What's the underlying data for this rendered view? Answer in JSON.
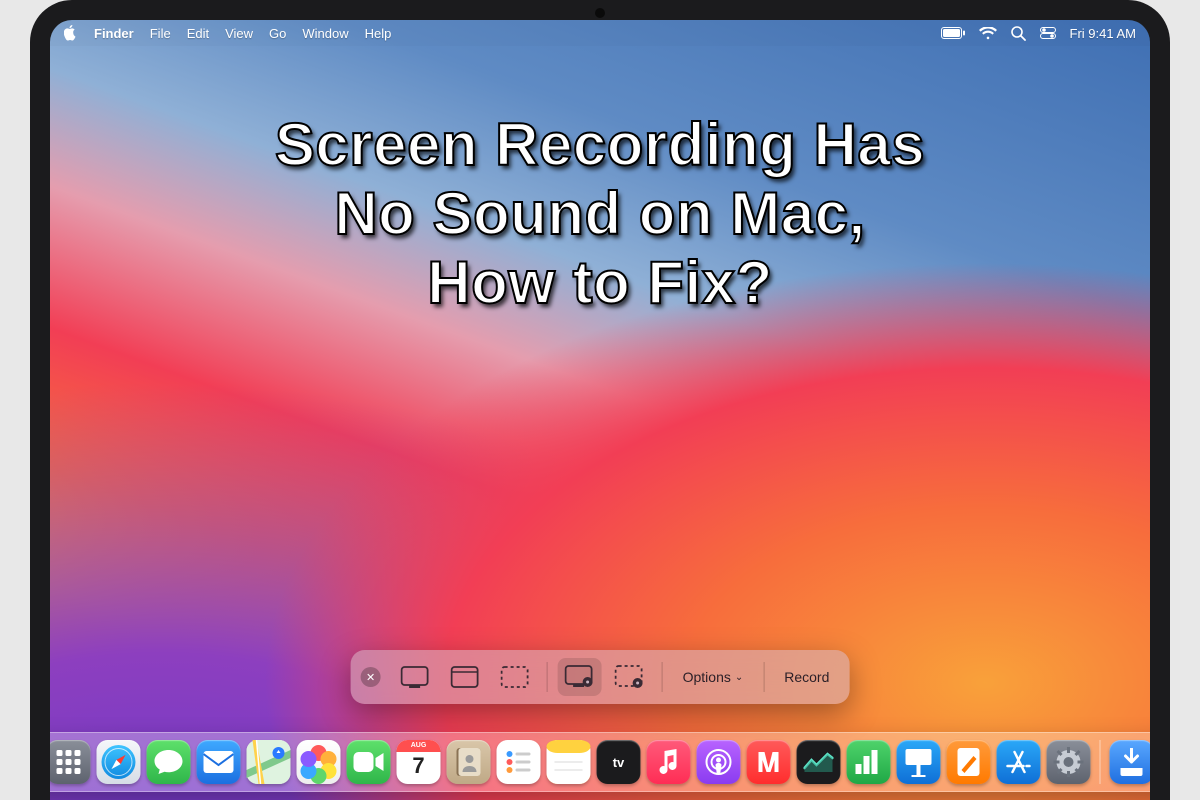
{
  "menubar": {
    "app": "Finder",
    "items": [
      "File",
      "Edit",
      "View",
      "Go",
      "Window",
      "Help"
    ],
    "clock": "Fri 9:41 AM"
  },
  "overlay": {
    "line1": "Screen Recording Has",
    "line2": "No Sound on Mac,",
    "line3": "How to Fix?"
  },
  "screenshot_toolbar": {
    "options_label": "Options",
    "record_label": "Record"
  },
  "calendar": {
    "month": "AUG",
    "day": "7"
  }
}
